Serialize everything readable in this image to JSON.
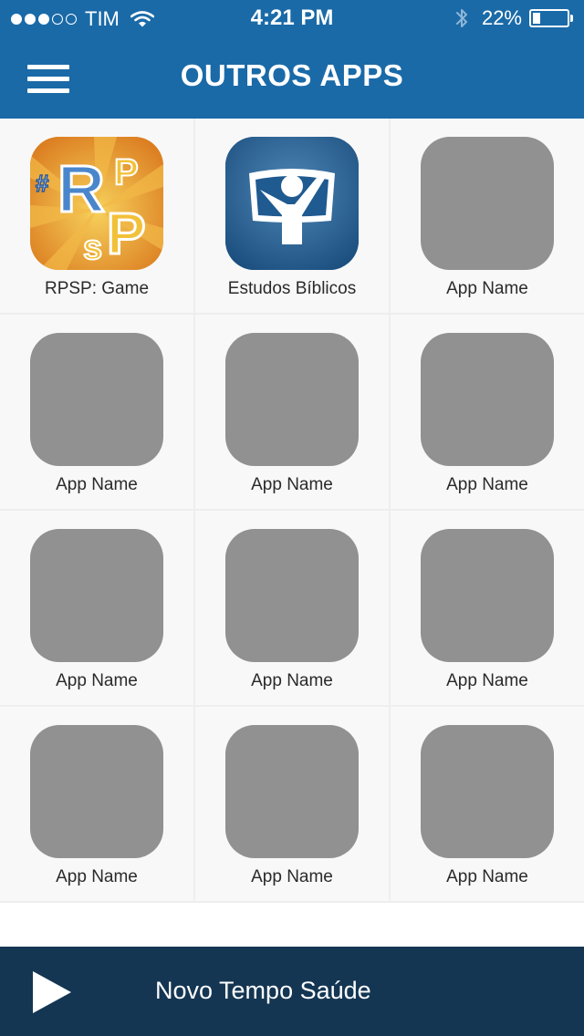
{
  "status_bar": {
    "carrier": "TIM",
    "signal_bars_filled": 3,
    "signal_bars_total": 5,
    "time": "4:21 PM",
    "battery_percent": "22%",
    "battery_level": 0.22
  },
  "header": {
    "title": "OUTROS APPS",
    "menu_icon": "hamburger-menu-icon",
    "background_color": "#1a6aa8"
  },
  "apps": [
    {
      "name": "RPSP: Game",
      "icon": "rpsp-game-icon"
    },
    {
      "name": "Estudos Bíblicos",
      "icon": "estudos-biblicos-icon"
    },
    {
      "name": "App Name",
      "icon": "placeholder-app-icon"
    },
    {
      "name": "App Name",
      "icon": "placeholder-app-icon"
    },
    {
      "name": "App Name",
      "icon": "placeholder-app-icon"
    },
    {
      "name": "App Name",
      "icon": "placeholder-app-icon"
    },
    {
      "name": "App Name",
      "icon": "placeholder-app-icon"
    },
    {
      "name": "App Name",
      "icon": "placeholder-app-icon"
    },
    {
      "name": "App Name",
      "icon": "placeholder-app-icon"
    },
    {
      "name": "App Name",
      "icon": "placeholder-app-icon"
    },
    {
      "name": "App Name",
      "icon": "placeholder-app-icon"
    },
    {
      "name": "App Name",
      "icon": "placeholder-app-icon"
    }
  ],
  "player": {
    "station": "Novo Tempo Saúde",
    "play_icon": "play-icon",
    "background_color": "#143653"
  }
}
